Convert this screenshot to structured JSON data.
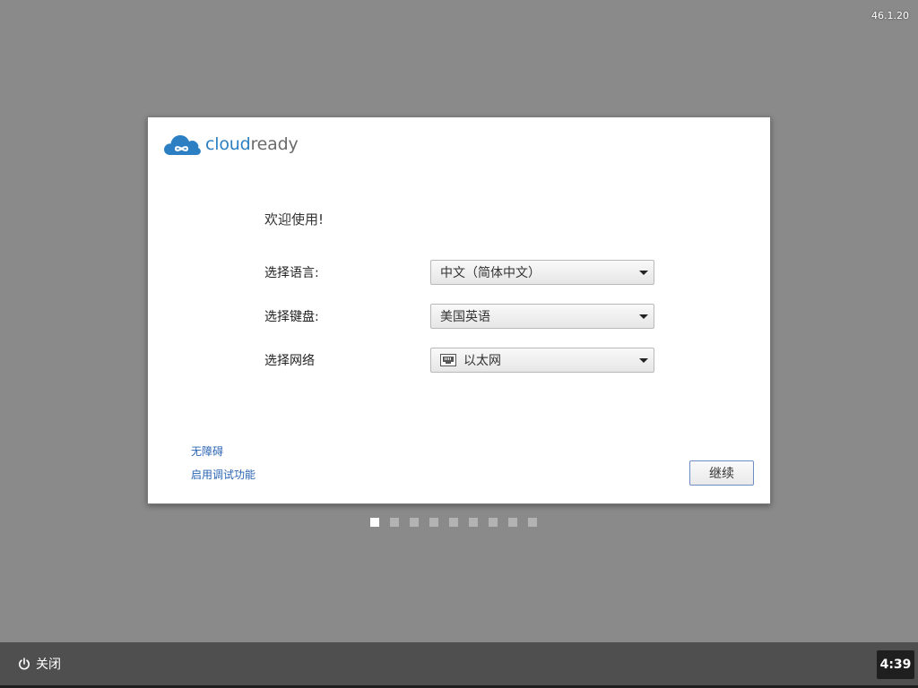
{
  "version": "46.1.20",
  "logo": {
    "part1": "cloud",
    "part2": "ready",
    "color_primary": "#2b7fc2",
    "color_secondary": "#6b6b6b"
  },
  "welcome_text": "欢迎使用!",
  "language": {
    "label": "选择语言:",
    "value": "中文（简体中文）"
  },
  "keyboard": {
    "label": "选择键盘:",
    "value": "美国英语"
  },
  "network": {
    "label": "选择网络",
    "value": "以太网",
    "icon": "ethernet-icon"
  },
  "links": {
    "accessibility": "无障碍",
    "debugging": "启用调试功能"
  },
  "continue_label": "继续",
  "pager": {
    "total": 9,
    "current": 1
  },
  "shelf": {
    "shutdown_label": "关闭",
    "shutdown_icon": "power-icon",
    "clock": "4:39"
  }
}
